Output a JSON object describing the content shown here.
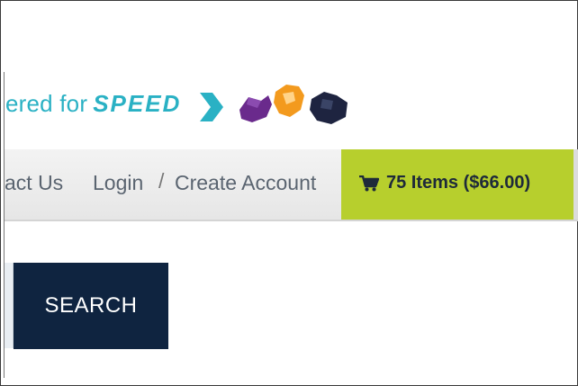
{
  "logo": {
    "tagline": "ered for",
    "speed_word": "SPEED",
    "colors": {
      "tagline": "#2ab1c4"
    }
  },
  "nav": {
    "contact_label": "act Us",
    "login_label": "Login",
    "separator": "/",
    "create_account_label": "Create Account"
  },
  "cart": {
    "icon": "cart-icon",
    "summary": "75 Items ($66.00)",
    "color": "#b7cf2d"
  },
  "search": {
    "button_label": "SEARCH",
    "button_color": "#0f2440"
  }
}
